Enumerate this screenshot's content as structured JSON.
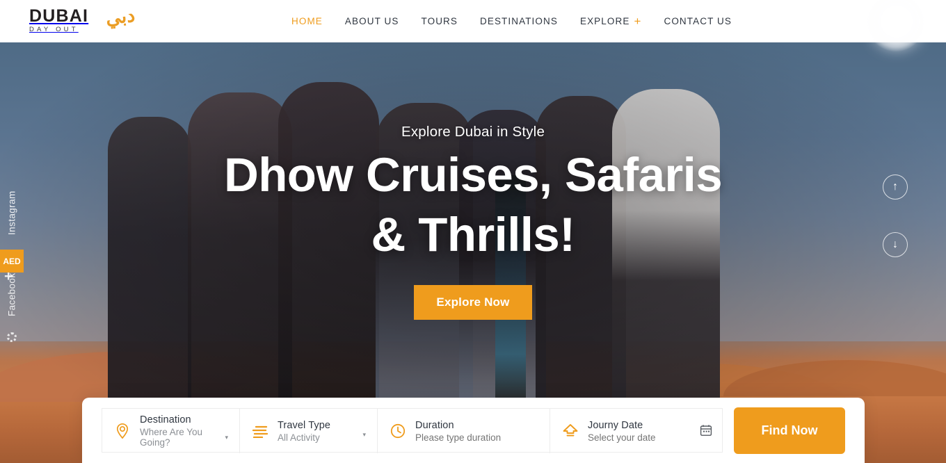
{
  "header": {
    "logo": {
      "main": "DUBAI",
      "sub": "DAY OUT",
      "arabic": "دبي"
    },
    "nav": [
      {
        "label": "HOME",
        "active": true
      },
      {
        "label": "ABOUT US",
        "active": false
      },
      {
        "label": "TOURS",
        "active": false
      },
      {
        "label": "DESTINATIONS",
        "active": false
      },
      {
        "label": "EXPLORE",
        "active": false,
        "plus": "+"
      },
      {
        "label": "CONTACT US",
        "active": false
      }
    ]
  },
  "hero": {
    "subtitle": "Explore Dubai in Style",
    "title_line1": "Dhow Cruises, Safaris",
    "title_line2": "& Thrills!",
    "cta_label": "Explore Now"
  },
  "side_nav": {
    "up_icon": "↑",
    "down_icon": "↓"
  },
  "social_rail": {
    "instagram": "Instagram",
    "facebook": "Facebook",
    "plus": "+",
    "currency_badge": "AED"
  },
  "search": {
    "destination": {
      "label": "Destination",
      "value": "Where Are You Going?",
      "icon": "map-pin-icon",
      "caret": "▾"
    },
    "travel_type": {
      "label": "Travel Type",
      "value": "All Activity",
      "icon": "list-lines-icon",
      "caret": "▾"
    },
    "duration": {
      "label": "Duration",
      "placeholder": "Please type duration",
      "value": "",
      "icon": "clock-icon"
    },
    "journey_date": {
      "label": "Journy Date",
      "placeholder": "Select your date",
      "value": "",
      "icon": "upload-arrow-icon",
      "calendar_icon": "calendar-icon"
    },
    "find_label": "Find Now"
  },
  "colors": {
    "accent": "#ef9c1d",
    "text_dark": "#2f3640",
    "text_muted": "#8b8f94"
  }
}
